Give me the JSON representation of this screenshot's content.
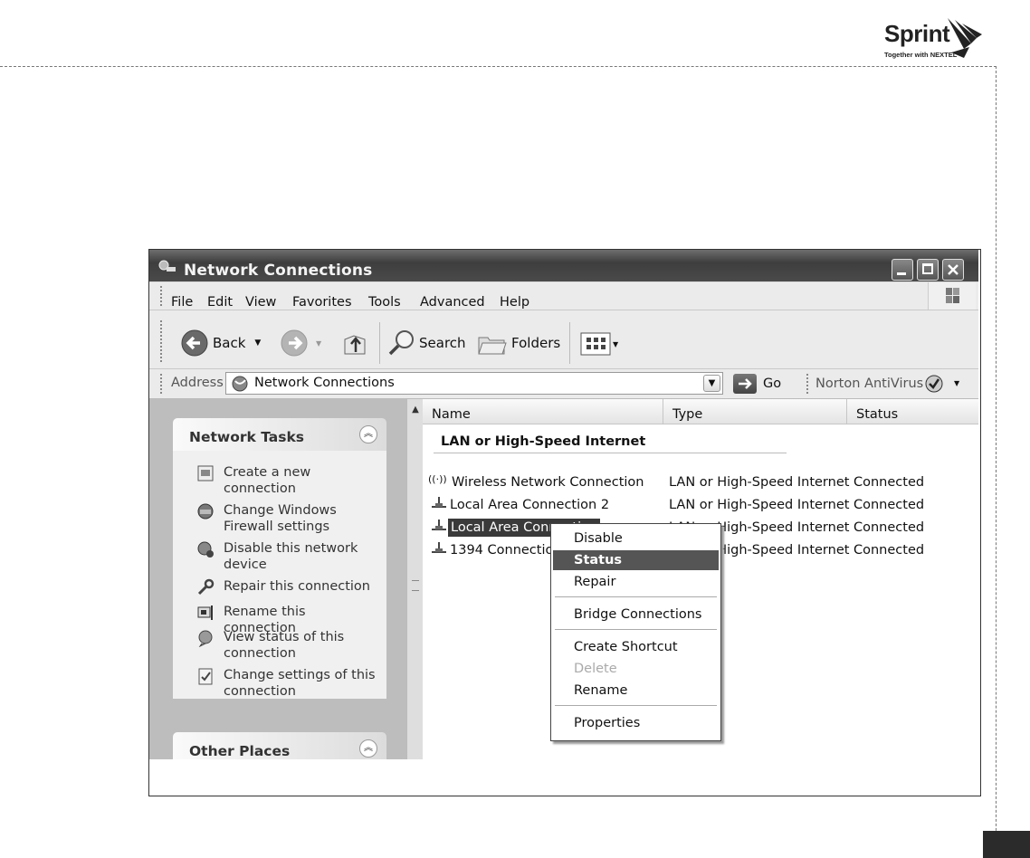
{
  "brand": {
    "name": "Sprint",
    "tagline": "Together with NEXTEL"
  },
  "window": {
    "title": "Network Connections",
    "menu": [
      "File",
      "Edit",
      "View",
      "Favorites",
      "Tools",
      "Advanced",
      "Help"
    ],
    "toolbar": {
      "back": "Back",
      "search": "Search",
      "folders": "Folders"
    },
    "address": {
      "label": "Address",
      "value": "Network Connections",
      "go": "Go",
      "norton": "Norton AntiVirus"
    }
  },
  "left_pane": {
    "network_tasks": {
      "title": "Network Tasks",
      "items": [
        {
          "label": "Create a new connection",
          "icon": "new-connection-icon"
        },
        {
          "label": "Change Windows Firewall settings",
          "icon": "firewall-icon"
        },
        {
          "label": "Disable this network device",
          "icon": "disable-network-icon"
        },
        {
          "label": "Repair this connection",
          "icon": "repair-icon"
        },
        {
          "label": "Rename this connection",
          "icon": "rename-icon"
        },
        {
          "label": "View status of this connection",
          "icon": "status-icon"
        },
        {
          "label": "Change settings of this connection",
          "icon": "settings-icon"
        }
      ]
    },
    "other_places": {
      "title": "Other Places"
    }
  },
  "list": {
    "columns": [
      "Name",
      "Type",
      "Status"
    ],
    "group": "LAN or High-Speed Internet",
    "rows": [
      {
        "name": "Wireless Network Connection",
        "type": "LAN or High-Speed Internet",
        "status": "Connected",
        "selected": false
      },
      {
        "name": "Local Area Connection 2",
        "type": "LAN or High-Speed Internet",
        "status": "Connected",
        "selected": false
      },
      {
        "name": "Local Area Connection",
        "type": "LAN or High-Speed Internet",
        "status": "Connected",
        "selected": true
      },
      {
        "name": "1394 Connection",
        "type": "LAN or High-Speed Internet",
        "status": "Connected",
        "selected": false
      }
    ]
  },
  "context_menu": {
    "items": [
      {
        "label": "Disable",
        "state": "normal"
      },
      {
        "label": "Status",
        "state": "highlighted"
      },
      {
        "label": "Repair",
        "state": "normal"
      },
      {
        "label": "Bridge Connections",
        "state": "normal"
      },
      {
        "label": "Create Shortcut",
        "state": "normal"
      },
      {
        "label": "Delete",
        "state": "disabled"
      },
      {
        "label": "Rename",
        "state": "normal"
      },
      {
        "label": "Properties",
        "state": "normal"
      }
    ]
  }
}
